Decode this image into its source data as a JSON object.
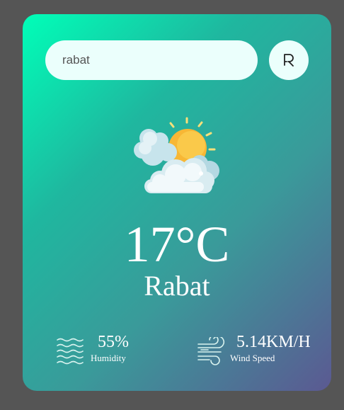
{
  "search": {
    "value": "rabat",
    "placeholder": "",
    "button_icon": "search-icon"
  },
  "weather": {
    "icon": "partly-cloudy-icon",
    "temperature": "17°C",
    "city": "Rabat"
  },
  "details": {
    "humidity": {
      "icon": "humidity-waves-icon",
      "value": "55%",
      "label": "Humidity"
    },
    "wind": {
      "icon": "wind-icon",
      "value": "5.14KM/H",
      "label": "Wind Speed"
    }
  },
  "colors": {
    "page_background": "#555555",
    "gradient_start": "#00ffb8",
    "gradient_end": "#5b5992",
    "input_background": "#ebfffc",
    "text": "#ffffff"
  }
}
